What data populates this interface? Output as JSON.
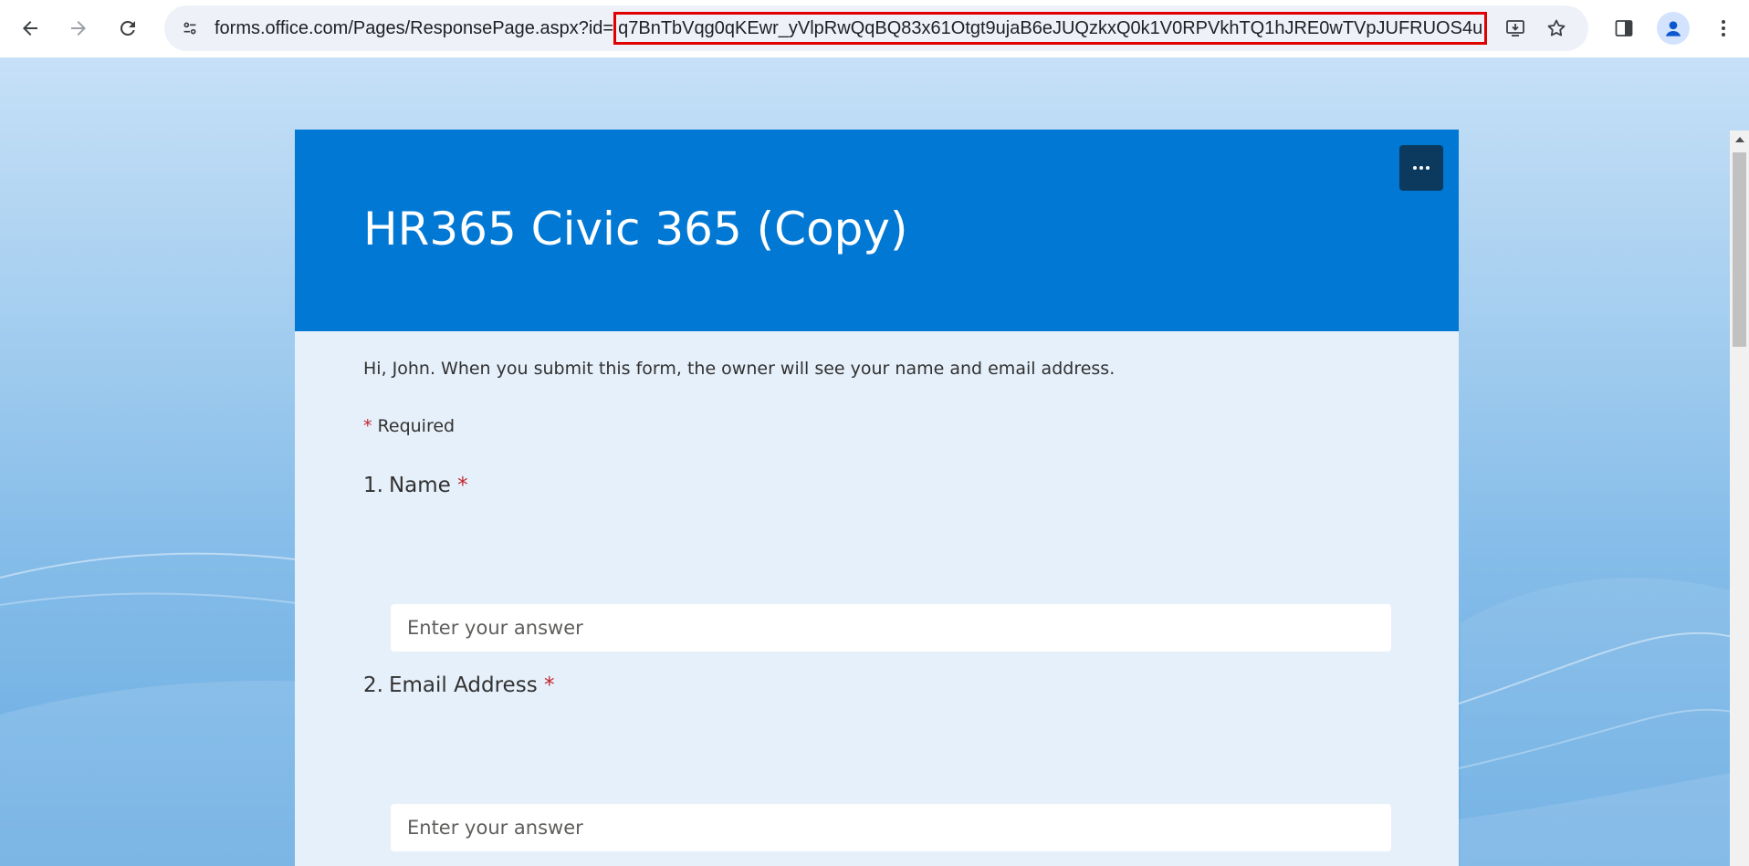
{
  "browser": {
    "url_prefix": "forms.office.com/Pages/ResponsePage.aspx?id=",
    "url_id": "q7BnTbVqg0qKEwr_yVlpRwQqBQ83x61Otgt9ujaB6eJUQzkxQ0k1V0RPVkhTQ1hJRE0wTVpJUFRUOS4u",
    "icons": {
      "back": "back-arrow-icon",
      "forward": "forward-arrow-icon",
      "reload": "reload-icon",
      "site_info": "tune-icon",
      "install": "install-app-icon",
      "bookmark": "star-icon",
      "side_panel": "side-panel-icon",
      "profile": "profile-avatar-icon",
      "menu": "kebab-menu-icon"
    }
  },
  "form": {
    "title": "HR365 Civic 365 (Copy)",
    "intro": "Hi, John. When you submit this form, the owner will see your name and email address.",
    "required_star": "*",
    "required_label": "Required",
    "questions": [
      {
        "number": "1.",
        "label": "Name",
        "star": "*",
        "placeholder": "Enter your answer",
        "value": ""
      },
      {
        "number": "2.",
        "label": "Email Address",
        "star": "*",
        "placeholder": "Enter your answer",
        "value": ""
      }
    ],
    "more_icon": "more-horizontal-icon"
  },
  "colors": {
    "header_blue": "#0078d4",
    "more_button": "#0b3a5e",
    "required_red": "#c4262e",
    "url_highlight": "#e00000"
  }
}
